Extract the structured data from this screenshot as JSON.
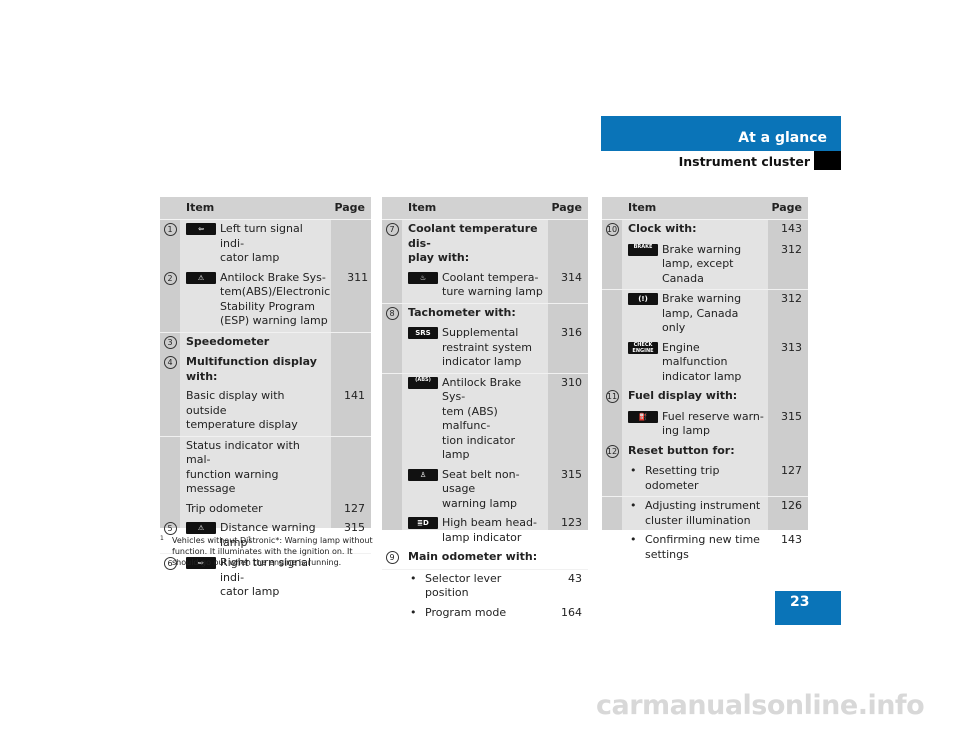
{
  "header": {
    "section": "At a glance",
    "subsection": "Instrument cluster",
    "accent_color": "#0a74b8"
  },
  "page_number": "23",
  "tables": [
    {
      "col_item": "Item",
      "col_page": "Page",
      "rows": [
        {
          "type": "icon",
          "num": "1",
          "icon": "left-turn-signal-icon",
          "glyph": "⇦",
          "text": "Left turn signal indi-\ncator lamp",
          "page": "",
          "sep": false
        },
        {
          "type": "icon",
          "num": "2",
          "icon": "warning-triangle-icon",
          "glyph": "⚠",
          "text": "Antilock Brake Sys-\ntem(ABS)/Electronic\nStability Program\n(ESP) warning lamp",
          "page": "311",
          "sep": false
        },
        {
          "type": "heading",
          "num": "3",
          "text": "Speedometer",
          "page": "",
          "sep": true
        },
        {
          "type": "heading",
          "num": "4",
          "text": "Multifunction display\nwith:",
          "page": "",
          "sep": false
        },
        {
          "type": "sub",
          "text": "Basic display with outside\ntemperature display",
          "page": "141",
          "sep": false
        },
        {
          "type": "sub",
          "text": "Status indicator with mal-\nfunction warning message",
          "page": "",
          "sep": true
        },
        {
          "type": "sub",
          "text": "Trip odometer",
          "page": "127",
          "sep": false
        },
        {
          "type": "icon",
          "num": "5",
          "icon": "distance-warning-icon",
          "glyph": "⚠",
          "text": "Distance warning\nlamp",
          "sup": "1",
          "page": "315",
          "sep": false
        },
        {
          "type": "icon",
          "num": "6",
          "icon": "right-turn-signal-icon",
          "glyph": "⇨",
          "text": "Right turn signal indi-\ncator lamp",
          "page": "",
          "sep": true
        }
      ]
    },
    {
      "col_item": "Item",
      "col_page": "Page",
      "rows": [
        {
          "type": "heading",
          "num": "7",
          "text": "Coolant temperature dis-\nplay with:",
          "page": "",
          "sep": false
        },
        {
          "type": "iconsub",
          "icon": "coolant-temperature-icon",
          "glyph": "♨",
          "text": "Coolant tempera-\nture warning lamp",
          "page": "314",
          "sep": false
        },
        {
          "type": "heading",
          "num": "8",
          "text": "Tachometer with:",
          "page": "",
          "sep": true
        },
        {
          "type": "iconsub",
          "icon": "srs-icon",
          "glyph": "SRS",
          "text": "Supplemental\nrestraint system\nindicator lamp",
          "page": "316",
          "sep": false
        },
        {
          "type": "iconsub",
          "icon": "abs-icon",
          "glyph": "(ABS)",
          "text": "Antilock Brake Sys-\ntem (ABS) malfunc-\ntion indicator lamp",
          "page": "310",
          "sep": true
        },
        {
          "type": "iconsub",
          "icon": "seat-belt-icon",
          "glyph": "♙",
          "text": "Seat belt non-usage\nwarning lamp",
          "page": "315",
          "sep": false
        },
        {
          "type": "iconsub",
          "icon": "high-beam-icon",
          "glyph": "≣D",
          "text": "High beam head-\nlamp indicator",
          "page": "123",
          "sep": false
        },
        {
          "type": "heading",
          "num": "9",
          "text": "Main odometer with:",
          "page": "",
          "sep": false
        },
        {
          "type": "bullet",
          "text": "Selector lever position",
          "page": "43",
          "sep": true
        },
        {
          "type": "bullet",
          "text": "Program mode",
          "page": "164",
          "sep": false
        }
      ]
    },
    {
      "col_item": "Item",
      "col_page": "Page",
      "rows": [
        {
          "type": "heading",
          "num": "10",
          "text": "Clock with:",
          "page": "143",
          "sep": false
        },
        {
          "type": "iconsub",
          "icon": "brake-text-icon",
          "glyph": "BRAKE",
          "text": "Brake warning\nlamp, except\nCanada",
          "page": "312",
          "sep": false
        },
        {
          "type": "iconsub",
          "icon": "brake-circle-icon",
          "glyph": "(!)",
          "text": "Brake warning\nlamp, Canada only",
          "page": "312",
          "sep": true
        },
        {
          "type": "iconsub",
          "icon": "check-engine-icon",
          "glyph": "CHECK ENGINE",
          "text": "Engine malfunction\nindicator lamp",
          "page": "313",
          "sep": false
        },
        {
          "type": "heading",
          "num": "11",
          "text": "Fuel display with:",
          "page": "",
          "sep": false
        },
        {
          "type": "iconsub",
          "icon": "fuel-pump-icon",
          "glyph": "⛽",
          "text": "Fuel reserve warn-\ning lamp",
          "page": "315",
          "sep": false
        },
        {
          "type": "heading",
          "num": "12",
          "text": "Reset button for:",
          "page": "",
          "sep": false
        },
        {
          "type": "bullet",
          "text": "Resetting trip\nodometer",
          "page": "127",
          "sep": false
        },
        {
          "type": "bullet",
          "text": "Adjusting instrument\ncluster illumination",
          "page": "126",
          "sep": true
        },
        {
          "type": "bullet",
          "text": "Confirming new time\nsettings",
          "page": "143",
          "sep": false
        }
      ]
    }
  ],
  "footnote": {
    "mark": "1",
    "text": "Vehicles without Distronic*: Warning lamp without function. It illuminates with the ignition on. It should go out when the engine is running."
  },
  "watermark": "carmanualsonline.info"
}
